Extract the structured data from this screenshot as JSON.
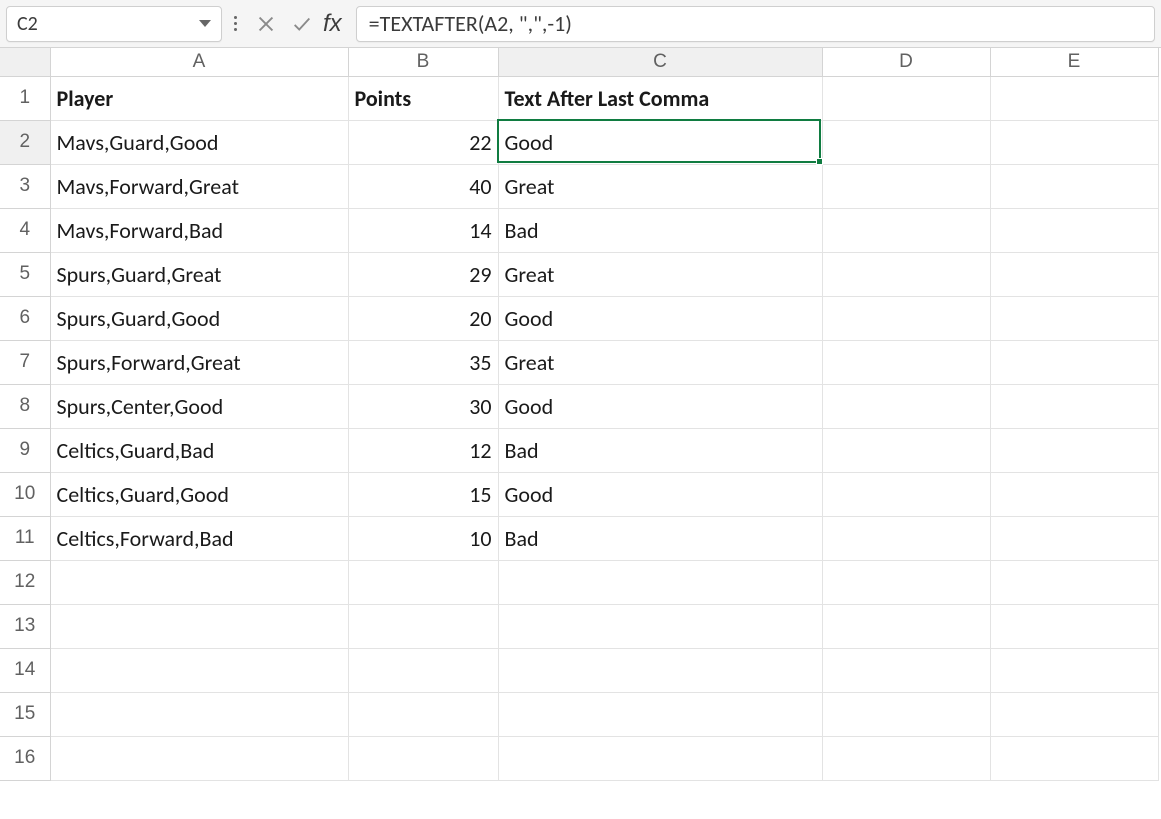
{
  "nameBox": {
    "value": "C2"
  },
  "formulaBar": {
    "value": "=TEXTAFTER(A2, \",\",-1)"
  },
  "columns": [
    "A",
    "B",
    "C",
    "D",
    "E"
  ],
  "rowCount": 16,
  "activeCol": "C",
  "activeRow": 2,
  "headers": {
    "A": "Player",
    "B": "Points",
    "C": "Text After Last Comma"
  },
  "rows": [
    {
      "A": "Mavs,Guard,Good",
      "B": 22,
      "C": "Good"
    },
    {
      "A": "Mavs,Forward,Great",
      "B": 40,
      "C": "Great"
    },
    {
      "A": "Mavs,Forward,Bad",
      "B": 14,
      "C": "Bad"
    },
    {
      "A": "Spurs,Guard,Great",
      "B": 29,
      "C": "Great"
    },
    {
      "A": "Spurs,Guard,Good",
      "B": 20,
      "C": "Good"
    },
    {
      "A": "Spurs,Forward,Great",
      "B": 35,
      "C": "Great"
    },
    {
      "A": "Spurs,Center,Good",
      "B": 30,
      "C": "Good"
    },
    {
      "A": "Celtics,Guard,Bad",
      "B": 12,
      "C": "Bad"
    },
    {
      "A": "Celtics,Guard,Good",
      "B": 15,
      "C": "Good"
    },
    {
      "A": "Celtics,Forward,Bad",
      "B": 10,
      "C": "Bad"
    }
  ],
  "colWidths": {
    "A": 298,
    "B": 150,
    "C": 324,
    "D": 168,
    "E": 168
  },
  "rowHdrWidth": 50,
  "hdrRowHeight": 28,
  "cellHeight": 44,
  "chart_data": {
    "type": "table",
    "columns": [
      "Player",
      "Points",
      "Text After Last Comma"
    ],
    "data": [
      [
        "Mavs,Guard,Good",
        22,
        "Good"
      ],
      [
        "Mavs,Forward,Great",
        40,
        "Great"
      ],
      [
        "Mavs,Forward,Bad",
        14,
        "Bad"
      ],
      [
        "Spurs,Guard,Great",
        29,
        "Great"
      ],
      [
        "Spurs,Guard,Good",
        20,
        "Good"
      ],
      [
        "Spurs,Forward,Great",
        35,
        "Great"
      ],
      [
        "Spurs,Center,Good",
        30,
        "Good"
      ],
      [
        "Celtics,Guard,Bad",
        12,
        "Bad"
      ],
      [
        "Celtics,Guard,Good",
        15,
        "Good"
      ],
      [
        "Celtics,Forward,Bad",
        10,
        "Bad"
      ]
    ]
  }
}
